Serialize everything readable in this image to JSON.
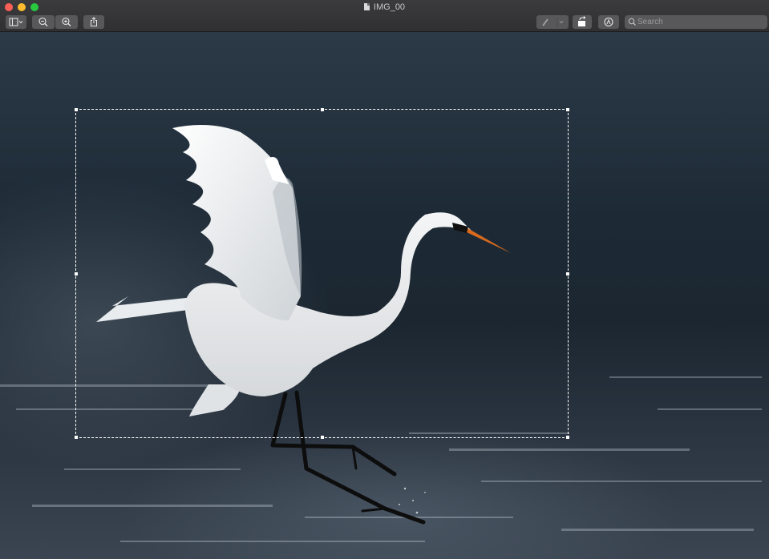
{
  "window": {
    "title": "IMG_00"
  },
  "toolbar": {
    "sidebar_icon": "sidebar-icon",
    "zoom_out_icon": "zoom-out-icon",
    "zoom_in_icon": "zoom-in-icon",
    "share_icon": "share-icon",
    "markup_pen_icon": "pen-icon",
    "rotate_icon": "rotate-icon",
    "annotate_icon": "markup-icon",
    "search_placeholder": "Search"
  },
  "colors": {
    "close": "#fe5f57",
    "minimize": "#febc2e",
    "maximize": "#28c840",
    "toolbar_button": "#58585a",
    "selection": "#ffffff"
  }
}
